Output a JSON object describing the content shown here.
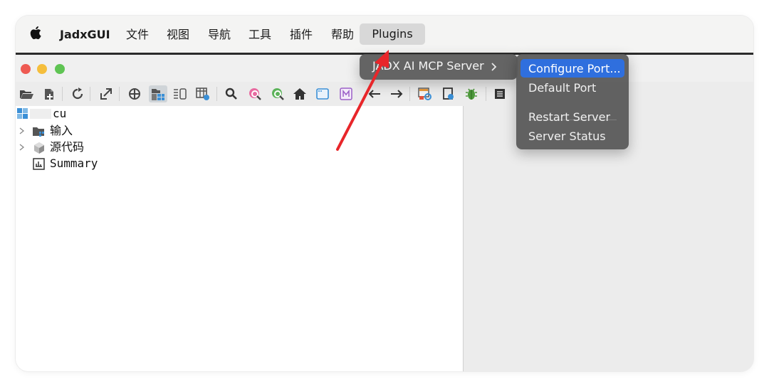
{
  "menubar": {
    "app_name": "JadxGUI",
    "items": [
      "文件",
      "视图",
      "导航",
      "工具",
      "插件",
      "帮助"
    ],
    "plugins_label": "Plugins"
  },
  "menu": {
    "submenu_label": "JADX AI MCP Server",
    "items": [
      "Configure Port...",
      "Default Port",
      "Restart Server",
      "Server Status"
    ]
  },
  "tree": {
    "root_label": "cu",
    "items": [
      "输入",
      "源代码",
      "Summary"
    ]
  },
  "colors": {
    "menu_highlight": "#2f6fde",
    "annotation_arrow": "#e8262a"
  }
}
